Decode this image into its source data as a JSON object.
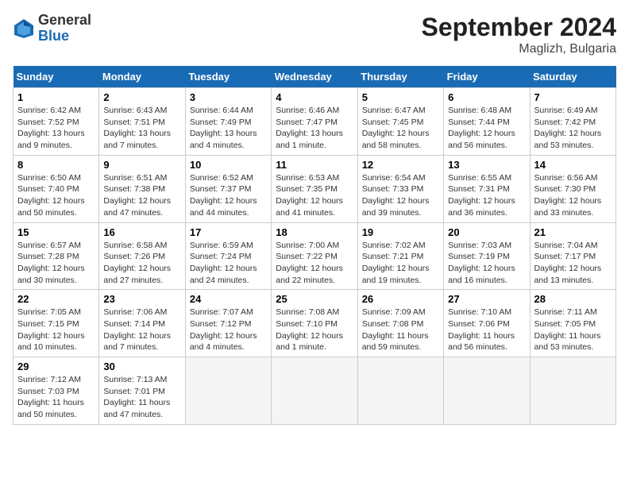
{
  "header": {
    "logo_general": "General",
    "logo_blue": "Blue",
    "month_title": "September 2024",
    "location": "Maglizh, Bulgaria"
  },
  "days_of_week": [
    "Sunday",
    "Monday",
    "Tuesday",
    "Wednesday",
    "Thursday",
    "Friday",
    "Saturday"
  ],
  "weeks": [
    [
      {
        "day": 1,
        "info": "Sunrise: 6:42 AM\nSunset: 7:52 PM\nDaylight: 13 hours\nand 9 minutes."
      },
      {
        "day": 2,
        "info": "Sunrise: 6:43 AM\nSunset: 7:51 PM\nDaylight: 13 hours\nand 7 minutes."
      },
      {
        "day": 3,
        "info": "Sunrise: 6:44 AM\nSunset: 7:49 PM\nDaylight: 13 hours\nand 4 minutes."
      },
      {
        "day": 4,
        "info": "Sunrise: 6:46 AM\nSunset: 7:47 PM\nDaylight: 13 hours\nand 1 minute."
      },
      {
        "day": 5,
        "info": "Sunrise: 6:47 AM\nSunset: 7:45 PM\nDaylight: 12 hours\nand 58 minutes."
      },
      {
        "day": 6,
        "info": "Sunrise: 6:48 AM\nSunset: 7:44 PM\nDaylight: 12 hours\nand 56 minutes."
      },
      {
        "day": 7,
        "info": "Sunrise: 6:49 AM\nSunset: 7:42 PM\nDaylight: 12 hours\nand 53 minutes."
      }
    ],
    [
      {
        "day": 8,
        "info": "Sunrise: 6:50 AM\nSunset: 7:40 PM\nDaylight: 12 hours\nand 50 minutes."
      },
      {
        "day": 9,
        "info": "Sunrise: 6:51 AM\nSunset: 7:38 PM\nDaylight: 12 hours\nand 47 minutes."
      },
      {
        "day": 10,
        "info": "Sunrise: 6:52 AM\nSunset: 7:37 PM\nDaylight: 12 hours\nand 44 minutes."
      },
      {
        "day": 11,
        "info": "Sunrise: 6:53 AM\nSunset: 7:35 PM\nDaylight: 12 hours\nand 41 minutes."
      },
      {
        "day": 12,
        "info": "Sunrise: 6:54 AM\nSunset: 7:33 PM\nDaylight: 12 hours\nand 39 minutes."
      },
      {
        "day": 13,
        "info": "Sunrise: 6:55 AM\nSunset: 7:31 PM\nDaylight: 12 hours\nand 36 minutes."
      },
      {
        "day": 14,
        "info": "Sunrise: 6:56 AM\nSunset: 7:30 PM\nDaylight: 12 hours\nand 33 minutes."
      }
    ],
    [
      {
        "day": 15,
        "info": "Sunrise: 6:57 AM\nSunset: 7:28 PM\nDaylight: 12 hours\nand 30 minutes."
      },
      {
        "day": 16,
        "info": "Sunrise: 6:58 AM\nSunset: 7:26 PM\nDaylight: 12 hours\nand 27 minutes."
      },
      {
        "day": 17,
        "info": "Sunrise: 6:59 AM\nSunset: 7:24 PM\nDaylight: 12 hours\nand 24 minutes."
      },
      {
        "day": 18,
        "info": "Sunrise: 7:00 AM\nSunset: 7:22 PM\nDaylight: 12 hours\nand 22 minutes."
      },
      {
        "day": 19,
        "info": "Sunrise: 7:02 AM\nSunset: 7:21 PM\nDaylight: 12 hours\nand 19 minutes."
      },
      {
        "day": 20,
        "info": "Sunrise: 7:03 AM\nSunset: 7:19 PM\nDaylight: 12 hours\nand 16 minutes."
      },
      {
        "day": 21,
        "info": "Sunrise: 7:04 AM\nSunset: 7:17 PM\nDaylight: 12 hours\nand 13 minutes."
      }
    ],
    [
      {
        "day": 22,
        "info": "Sunrise: 7:05 AM\nSunset: 7:15 PM\nDaylight: 12 hours\nand 10 minutes."
      },
      {
        "day": 23,
        "info": "Sunrise: 7:06 AM\nSunset: 7:14 PM\nDaylight: 12 hours\nand 7 minutes."
      },
      {
        "day": 24,
        "info": "Sunrise: 7:07 AM\nSunset: 7:12 PM\nDaylight: 12 hours\nand 4 minutes."
      },
      {
        "day": 25,
        "info": "Sunrise: 7:08 AM\nSunset: 7:10 PM\nDaylight: 12 hours\nand 1 minute."
      },
      {
        "day": 26,
        "info": "Sunrise: 7:09 AM\nSunset: 7:08 PM\nDaylight: 11 hours\nand 59 minutes."
      },
      {
        "day": 27,
        "info": "Sunrise: 7:10 AM\nSunset: 7:06 PM\nDaylight: 11 hours\nand 56 minutes."
      },
      {
        "day": 28,
        "info": "Sunrise: 7:11 AM\nSunset: 7:05 PM\nDaylight: 11 hours\nand 53 minutes."
      }
    ],
    [
      {
        "day": 29,
        "info": "Sunrise: 7:12 AM\nSunset: 7:03 PM\nDaylight: 11 hours\nand 50 minutes."
      },
      {
        "day": 30,
        "info": "Sunrise: 7:13 AM\nSunset: 7:01 PM\nDaylight: 11 hours\nand 47 minutes."
      },
      null,
      null,
      null,
      null,
      null
    ]
  ]
}
